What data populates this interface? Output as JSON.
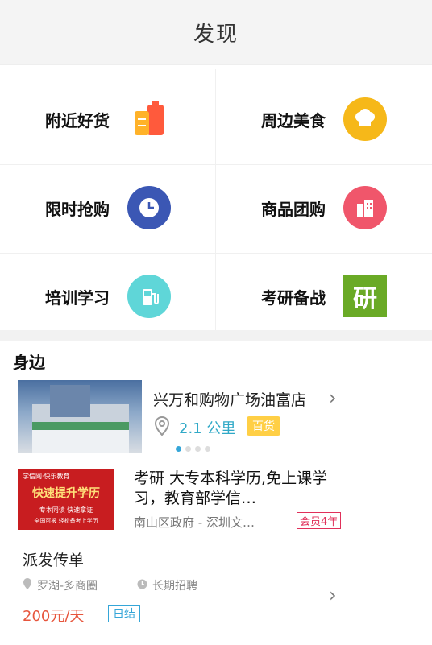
{
  "header": {
    "title": "发现"
  },
  "grid": [
    {
      "label": "附近好货",
      "icon": "luggage-icon",
      "color": "#ff5a3c"
    },
    {
      "label": "周边美食",
      "icon": "chef-hat-icon",
      "color": "#f6b819"
    },
    {
      "label": "限时抢购",
      "icon": "clock-icon",
      "color": "#3b57b4"
    },
    {
      "label": "商品团购",
      "icon": "buildings-icon",
      "color": "#f0566b"
    },
    {
      "label": "培训学习",
      "icon": "fuel-pump-icon",
      "color": "#5fd6d8"
    },
    {
      "label": "考研备战",
      "icon": "yan-badge-icon",
      "badge_text": "研",
      "color": "#6aaa26"
    }
  ],
  "nearby": {
    "title": "身边",
    "cards": [
      {
        "title": "兴万和购物广场油富店",
        "distance": "2.1 公里",
        "tag": "百货"
      },
      {
        "title": "考研 大专本科学历,免上课学习，教育部学信…",
        "location": "南山区政府 - 深圳文…",
        "badge": "会员4年",
        "thumb_heading": "快速提升学历",
        "thumb_line1": "专本同读  快速拿证",
        "thumb_line2": "全国可报  轻松备考上学历",
        "thumb_logo": "学信网·快乐教育"
      },
      {
        "title": "派发传单",
        "area": "罗湖-多商圈",
        "duration": "长期招聘",
        "price": "200元/天",
        "tag": "日结"
      }
    ]
  }
}
